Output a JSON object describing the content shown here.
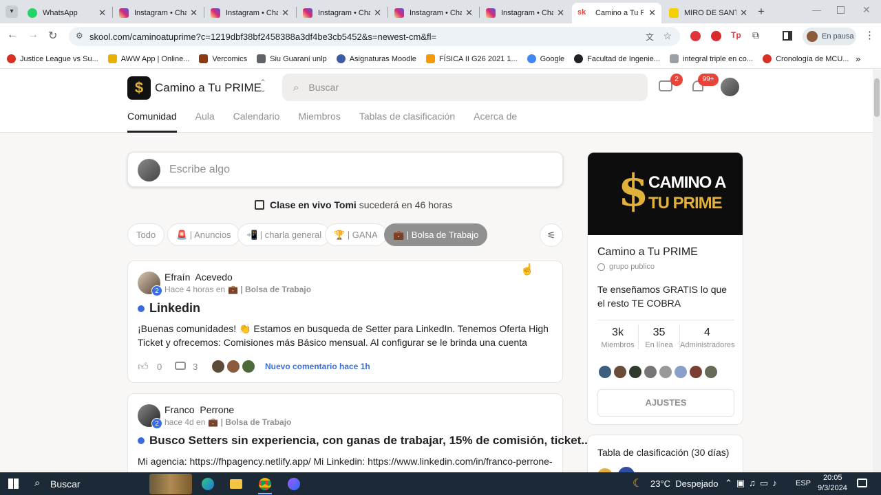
{
  "browser": {
    "tabs": [
      {
        "label": "WhatsApp",
        "color": "#25d366"
      },
      {
        "label": "Instagram • Chat",
        "color": "#d62976"
      },
      {
        "label": "Instagram • Chat",
        "color": "#d62976"
      },
      {
        "label": "Instagram • Chat",
        "color": "#d62976"
      },
      {
        "label": "Instagram • Chat",
        "color": "#d62976"
      },
      {
        "label": "Instagram • Chat",
        "color": "#d62976"
      },
      {
        "label": "Camino a Tu PRIME",
        "color": "#e8443a",
        "icon_text": "sk"
      },
      {
        "label": "MIRO DE SANTI",
        "color": "#f5d000"
      }
    ],
    "url": "skool.com/caminoatuprime?c=1219dbf38bf2458388a3df4be3cb5452&s=newest-cm&fl=",
    "profile_label": "En pausa",
    "bookmarks": [
      {
        "label": "Justice League vs Su...",
        "color": "#d93025"
      },
      {
        "label": "AWW App | Online...",
        "color": "#1a1a1a"
      },
      {
        "label": "Vercomics",
        "color": "#8a3b12"
      },
      {
        "label": "Siu Guaraní unlp",
        "color": "#5f6368"
      },
      {
        "label": "Asignaturas Moodle",
        "color": "#3c5aa6"
      },
      {
        "label": "FÍSICA II G26 2021 1...",
        "color": "#f59b00"
      },
      {
        "label": "Google",
        "color": "#4285f4"
      },
      {
        "label": "Facultad de Ingenie...",
        "color": "#202124"
      },
      {
        "label": "integral triple en co...",
        "color": "#5f6368"
      },
      {
        "label": "Cronología de MCU...",
        "color": "#d93025"
      }
    ]
  },
  "site": {
    "group_name": "Camino a Tu PRIME",
    "search_placeholder": "Buscar",
    "chat_badge": "2",
    "notif_badge": "99+",
    "nav": [
      "Comunidad",
      "Aula",
      "Calendario",
      "Miembros",
      "Tablas de clasificación",
      "Acerca de"
    ],
    "active_nav": "Comunidad"
  },
  "composer": {
    "placeholder": "Escribe algo"
  },
  "event": {
    "name": "Clase en vivo Tomi",
    "suffix": "sucederá en 46 horas"
  },
  "filters": [
    "Todo",
    "🚨 | Anuncios",
    "📲 | charla general",
    "🏆 | GANA",
    "💼 | Bolsa de Trabajo"
  ],
  "active_filter": "💼 | Bolsa de Trabajo",
  "posts": [
    {
      "author": "Efraín  Acevedo",
      "level": "2",
      "meta": "Hace 4 horas en",
      "category": "💼 | Bolsa de Trabajo",
      "title": "Linkedin",
      "body": "¡Buenas comunidades! 👏 Estamos en busqueda de Setter para LinkedIn. Tenemos Oferta High Ticket y ofrecemos: Comisiones más Básico mensual. Al configurar se le brinda una cuenta optimizada y con",
      "likes": "0",
      "comments": "3",
      "new_comment": "Nuevo comentario hace 1h"
    },
    {
      "author": "Franco  Perrone",
      "level": "2",
      "meta": "hace 4d en",
      "category": "💼 | Bolsa de Trabajo",
      "title": "Busco Setters sin experiencia, con ganas de trabajar, 15% de comisión, ticket...",
      "body": "Mi agencia: https://fhpagency.netlify.app/ Mi Linkedin: https://www.linkedin.com/in/franco-perrone-"
    }
  ],
  "sidebar": {
    "banner_line1": "CAMINO A",
    "banner_line2": "TU PRIME",
    "name": "Camino a Tu PRIME",
    "privacy": "grupo publico",
    "description": "Te enseñamos GRATIS lo que el resto TE COBRA",
    "stats": [
      {
        "value": "3k",
        "label": "Miembros"
      },
      {
        "value": "35",
        "label": "En línea"
      },
      {
        "value": "4",
        "label": "Administradores"
      }
    ],
    "settings_button": "AJUSTES",
    "leaderboard_title": "Tabla de clasificación (30 días)"
  },
  "taskbar": {
    "search_label": "Buscar",
    "weather": "23°C  Despejado",
    "language": "ESP",
    "time": "20:05",
    "date": "9/3/2024"
  }
}
